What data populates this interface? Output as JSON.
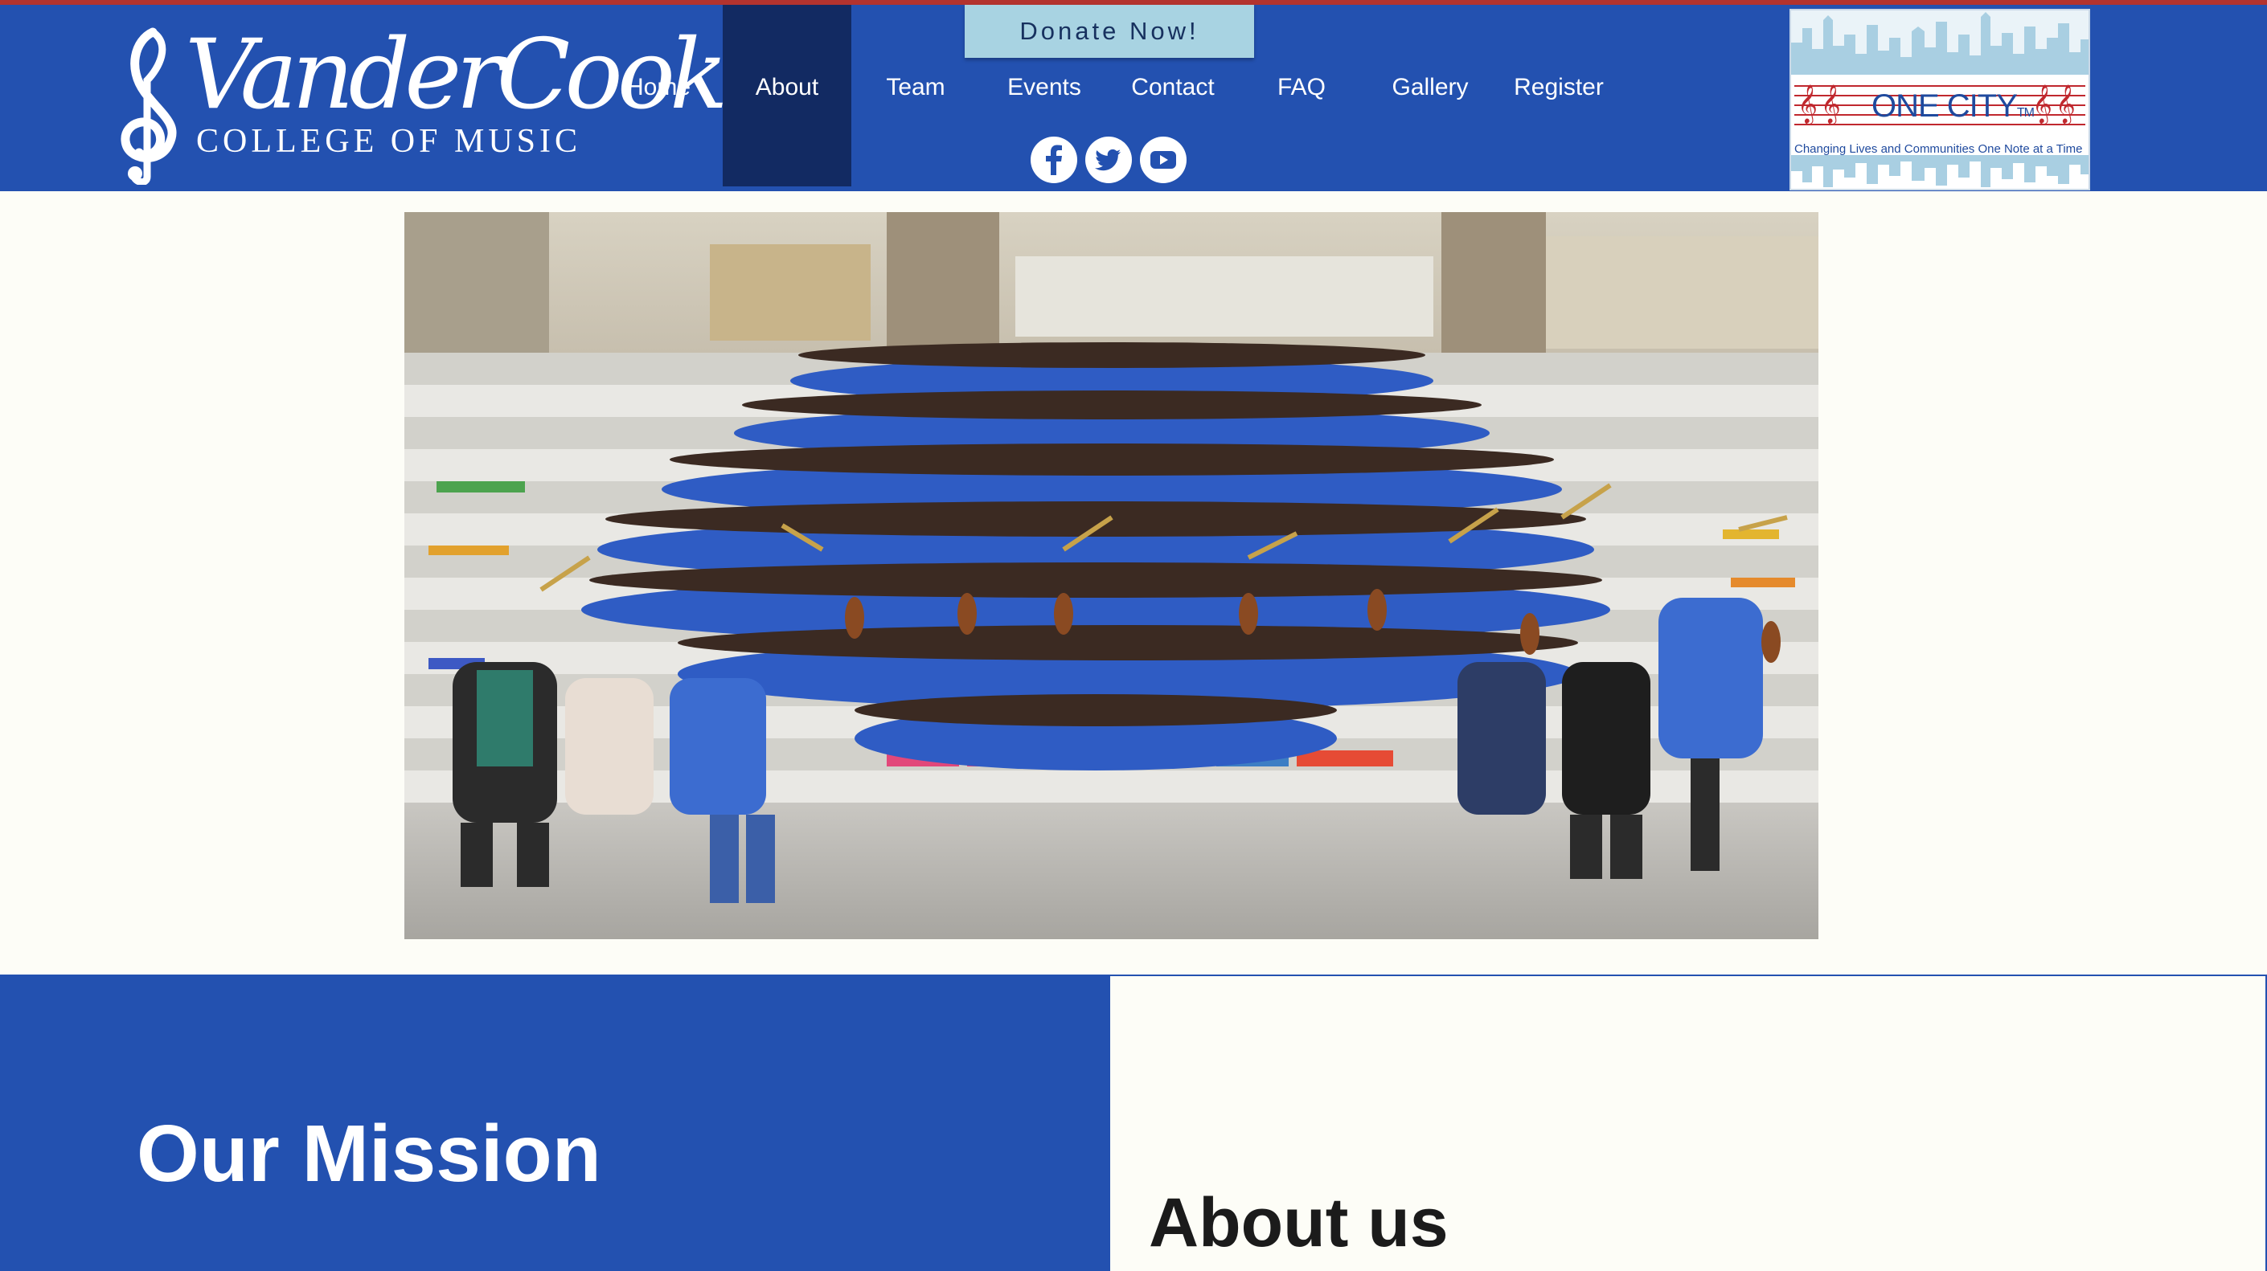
{
  "brand": {
    "name": "VanderCook",
    "subtitle": "COLLEGE OF MUSIC"
  },
  "nav": {
    "items": [
      {
        "label": "Home"
      },
      {
        "label": "About"
      },
      {
        "label": "Team"
      },
      {
        "label": "Events"
      },
      {
        "label": "Contact"
      },
      {
        "label": "FAQ"
      },
      {
        "label": "Gallery"
      },
      {
        "label": "Register"
      }
    ],
    "active": "About"
  },
  "donate": {
    "label": "Donate Now!"
  },
  "social": [
    "facebook-icon",
    "twitter-icon",
    "youtube-icon"
  ],
  "one_city": {
    "title": "ONE CITY",
    "tm": "TM",
    "clefs_left": "𝄞𝄞",
    "clefs_right": "𝄞𝄞",
    "tagline": "Changing Lives and Communities One Note at a Time"
  },
  "sections": {
    "mission_title": "Our Mission",
    "about_title": "About us"
  },
  "colors": {
    "brand_blue": "#2351B0",
    "nav_active": "#122A62",
    "donate_bg": "#A8D3E2",
    "accent_red": "#B3332E",
    "page_bg": "#FDFDF7"
  }
}
